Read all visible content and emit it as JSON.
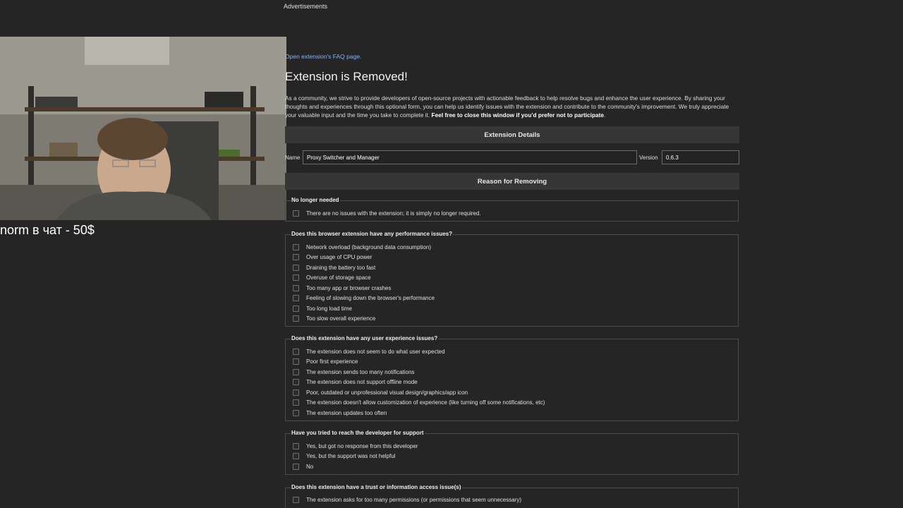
{
  "ads_label": "Advertisements",
  "overlay_text": "norm в чат - 50$",
  "faq_link": "Open extension's FAQ page.",
  "title": "Extension is Removed!",
  "intro": {
    "text": "As a community, we strive to provide developers of open-source projects with actionable feedback to help resolve bugs and enhance the user experience. By sharing your thoughts and experiences through this optional form, you can help us identify issues with the extension and contribute to the community's improvement. We truly appreciate your valuable input and the time you take to complete it. ",
    "bold": "Feel free to close this window if you'd prefer not to participate",
    "end": "."
  },
  "details": {
    "header": "Extension Details",
    "name_label": "Name",
    "name_value": "Proxy Switcher and Manager",
    "version_label": "Version",
    "version_value": "0.6.3"
  },
  "reason_header": "Reason for Removing",
  "groups": [
    {
      "legend": "No longer needed",
      "options": [
        "There are no issues with the extension; it is simply no longer required."
      ]
    },
    {
      "legend": "Does this browser extension have any performance issues?",
      "options": [
        "Network overload (background data consumption)",
        "Over usage of CPU power",
        "Draining the battery too fast",
        "Overuse of storage space",
        "Too many app or browser crashes",
        "Feeling of slowing down the browser's performance",
        "Too long load time",
        "Too slow overall experience"
      ]
    },
    {
      "legend": "Does this extension have any user experience issues?",
      "options": [
        "The extension does not seem to do what user expected",
        "Poor first experience",
        "The extension sends too many notifications",
        "The extension does not support offline mode",
        "Poor, outdated or unprofessional visual design/graphics/app icon",
        "The extension doesn't allow customization of experience (like turning off some notifications, etc)",
        "The extension updates too often"
      ]
    },
    {
      "legend": "Have you tried to reach the developer for support",
      "options": [
        "Yes, but got no response from this developer",
        "Yes, but the support was not helpful",
        "No"
      ]
    },
    {
      "legend": "Does this extension have a trust or information access issue(s)",
      "options": [
        "The extension asks for too many permissions (or permissions that seem unnecessary)"
      ]
    }
  ]
}
